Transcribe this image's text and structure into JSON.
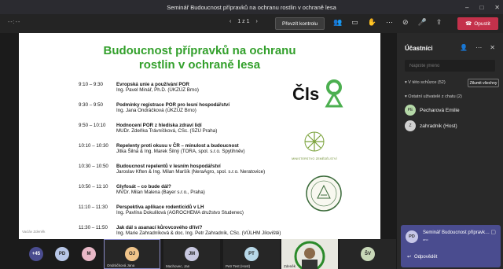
{
  "window": {
    "title": "Seminář Budoucnost přípravků na ochranu rostlin v ochraně lesa",
    "controls": [
      "–",
      "□",
      "✕"
    ]
  },
  "toolbar": {
    "left_text": "--:--",
    "page_indicator": "1 z 1",
    "take_control_label": "Převzít kontrolu",
    "leave_label": "Opustit"
  },
  "slide": {
    "title_line1": "Budoucnost přípravků na ochranu",
    "title_line2": "rostlin v ochraně lesa",
    "agenda": [
      {
        "time": "9:10 – 9:30",
        "talk": "Evropská unie a používání POR",
        "speaker": "Ing. Pavel Minář, Ph.D. (ÚKZÚZ Brno)"
      },
      {
        "time": "9:30 – 9:50",
        "talk": "Podmínky registrace POR pro lesní hospodářství",
        "speaker": "Ing. Jana Ondráčková (ÚKZÚZ Brno)"
      },
      {
        "time": "9:50 – 10:10",
        "talk": "Hodnocení POR z hlediska zdraví lidí",
        "speaker": "MUDr. Zdeňka Trávníčková, CSc. (SZÚ Praha)"
      },
      {
        "time": "10:10 – 10:30",
        "talk": "Repelenty proti okusu v ČR – minulost a budoucnost",
        "speaker": "Jitka Šilná & Ing. Marek Šilný (TORA, spol. s.r.o. Spytihněv)"
      },
      {
        "time": "10:30 – 10:50",
        "talk": "Budoucnost repelentů v lesním hospodářství",
        "speaker": "Jaroslav Kften & Ing. Milan Maršík (NeraAgro, spol. s.r.o. Neratovice)"
      },
      {
        "time": "10:50 – 11:10",
        "talk": "Glyfosát – co bude dál?",
        "speaker": "MVDr. Milan Malena (Bayer s.r.o., Praha)"
      },
      {
        "time": "11:10 – 11:30",
        "talk": "Perspektiva aplikace rodenticidů v LH",
        "speaker": "Ing. Pavlína Dokulilová (AGROCHEMA družstvo Studenec)"
      },
      {
        "time": "11:30 – 11:50",
        "talk": "Jak dál s asanací kůrovcového dříví?",
        "speaker": "Ing. Marie Zahradníková & doc. Ing. Petr Zahradník, CSc. (VÚLHM Jíloviště)"
      }
    ],
    "logo_cls_text": "Čls",
    "logo_ministry_caption": "MINISTERSTVO ZEMĚDĚLSTVÍ",
    "footer_text": "Vacláv Zdeněk"
  },
  "panel": {
    "title": "Účastníci",
    "search_placeholder": "Napište jméno",
    "in_meeting_label": "V této schůzce (52)",
    "admit_all_label": "Ztlumit všechny",
    "others_label": "Ostatní uživatelé z chatu (2)",
    "people": [
      {
        "initials": "PE",
        "name": "Pecharová Emilie",
        "color": "#b5d9a8"
      },
      {
        "initials": "Z",
        "name": "zahradnik (Host)",
        "color": "#d0d0d0"
      }
    ]
  },
  "participants_strip": [
    {
      "initials": "+45",
      "name": "",
      "color": "#4a4c8f"
    },
    {
      "initials": "PD",
      "name": "",
      "color": "#b8c7e8"
    },
    {
      "initials": "M",
      "name": "",
      "color": "#e8b8c7"
    },
    {
      "initials": "OJ",
      "name": "Ondráčková Jana",
      "color": "#f0c48a"
    },
    {
      "initials": "JM",
      "name": "Machovec, Jan",
      "color": "#c8c8e0"
    },
    {
      "initials": "PT",
      "name": "Petr Test (Host)",
      "color": "#b8d8e8"
    },
    {
      "initials": "",
      "name": "Zdeněk",
      "color": "#6a6"
    },
    {
      "initials": "ŠV",
      "name": "",
      "color": "#c8d8b8"
    }
  ],
  "toast": {
    "initials": "PD",
    "title": "Seminář Budoucnost přípravk…",
    "subtitle": "ano",
    "reply_label": "Odpovědět"
  }
}
